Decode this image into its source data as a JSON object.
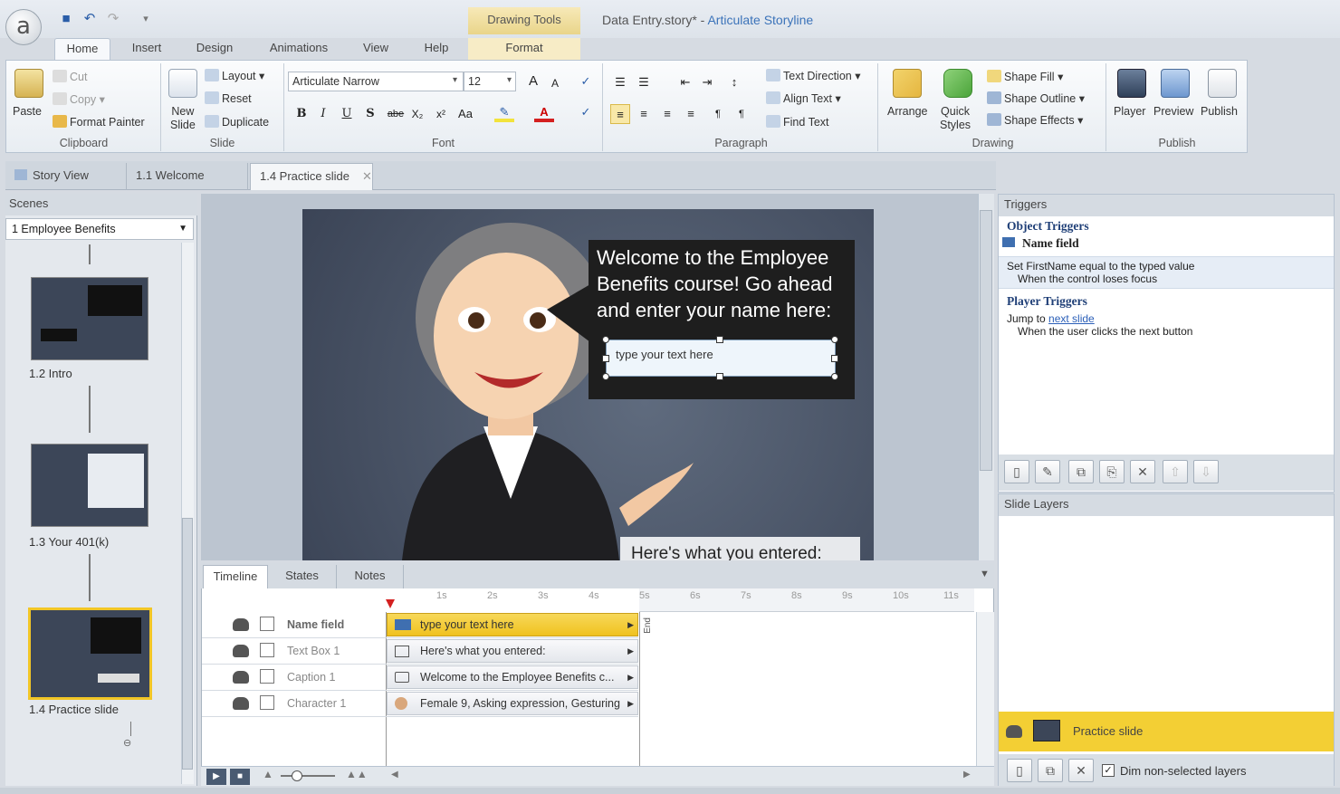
{
  "window": {
    "title_doc": "Data Entry.story* -",
    "title_app": "Articulate Storyline",
    "contextual_tab": "Drawing Tools"
  },
  "ribbon_tabs": [
    "Home",
    "Insert",
    "Design",
    "Animations",
    "View",
    "Help",
    "Format"
  ],
  "clipboard": {
    "paste": "Paste",
    "cut": "Cut",
    "copy": "Copy",
    "format_painter": "Format Painter",
    "label": "Clipboard"
  },
  "slide_group": {
    "new_slide_1": "New",
    "new_slide_2": "Slide",
    "layout": "Layout",
    "reset": "Reset",
    "duplicate": "Duplicate",
    "label": "Slide"
  },
  "font": {
    "name": "Articulate Narrow",
    "size": "12",
    "label": "Font",
    "bold": "B",
    "italic": "I",
    "underline": "U",
    "strike": "S",
    "abc": "abe",
    "sub": "X₂",
    "sup": "x²",
    "case": "Aa",
    "grow": "A",
    "shrink": "A"
  },
  "paragraph": {
    "text_direction": "Text Direction",
    "align_text": "Align Text",
    "find_text": "Find Text",
    "label": "Paragraph"
  },
  "drawing": {
    "arrange": "Arrange",
    "quick_styles_1": "Quick",
    "quick_styles_2": "Styles",
    "shape_fill": "Shape Fill",
    "shape_outline": "Shape Outline",
    "shape_effects": "Shape Effects",
    "label": "Drawing"
  },
  "publish": {
    "player": "Player",
    "preview": "Preview",
    "publish": "Publish",
    "label": "Publish"
  },
  "doc_tabs": [
    "Story View",
    "1.1 Welcome",
    "1.4 Practice slide"
  ],
  "scenes": {
    "header": "Scenes",
    "selected": "1 Employee Benefits",
    "slides": [
      "1.2 Intro",
      "1.3 Your 401(k)",
      "1.4 Practice slide"
    ]
  },
  "slide": {
    "speech": "Welcome to the Employee Benefits course! Go ahead and enter your name here:",
    "input_placeholder": "type your text here",
    "entered": "Here's what you entered:"
  },
  "timeline": {
    "tabs": [
      "Timeline",
      "States",
      "Notes"
    ],
    "ticks": [
      "1s",
      "2s",
      "3s",
      "4s",
      "5s",
      "6s",
      "7s",
      "8s",
      "9s",
      "10s",
      "11s"
    ],
    "end_label": "End",
    "rows": [
      {
        "name": "Name field",
        "bar": "type your text here"
      },
      {
        "name": "Text Box 1",
        "bar": "Here's what you entered:"
      },
      {
        "name": "Caption 1",
        "bar": "Welcome to the Employee Benefits c..."
      },
      {
        "name": "Character 1",
        "bar": "Female 9, Asking expression, Gesturing"
      }
    ]
  },
  "triggers": {
    "header": "Triggers",
    "object_heading": "Object Triggers",
    "object_name": "Name field",
    "object_action": "Set FirstName equal to the typed value",
    "object_when": "When the control loses focus",
    "player_heading": "Player Triggers",
    "player_action_pre": "Jump to",
    "player_action_link": "next slide",
    "player_when": "When the user clicks the next button"
  },
  "layers": {
    "header": "Slide Layers",
    "base_layer": "Practice slide",
    "dim_label": "Dim non-selected layers"
  },
  "colors": {
    "accent_gold": "#f2c626",
    "link_blue": "#2b5fb8",
    "app_blue": "#3b73b9"
  }
}
